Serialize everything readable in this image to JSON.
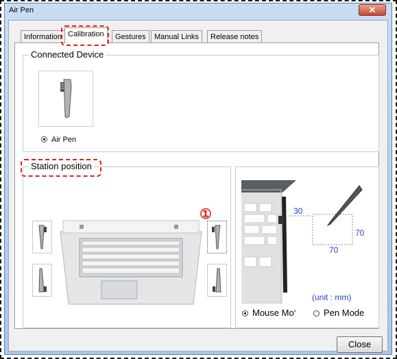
{
  "window": {
    "title": "Air Pen"
  },
  "tabs": [
    "Information",
    "Calibration",
    "Gestures",
    "Manual Links",
    "Release notes"
  ],
  "connected_device": {
    "label": "Connected Device",
    "device_option": "Air Pen"
  },
  "station_position": {
    "label": "Station position",
    "marker": "①"
  },
  "diagram": {
    "dim_horizontal": "30",
    "dim_vertical": "70",
    "dim_width": "70",
    "unit_label": "(unit : mm)"
  },
  "mode": {
    "mouse_mode": "Mouse Mo‘",
    "pen_mode": "Pen Mode"
  },
  "buttons": {
    "close": "Close"
  },
  "colors": {
    "accent": "#e0201a",
    "diagram_blue": "#2a3fbf"
  }
}
